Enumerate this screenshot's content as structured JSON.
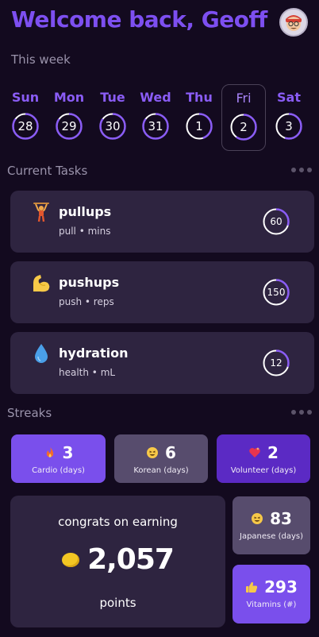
{
  "header": {
    "greeting": "Welcome back, Geoff",
    "avatar_icon": "avatar-face-icon"
  },
  "week": {
    "label": "This week",
    "days": [
      {
        "name": "Sun",
        "date": "28",
        "progress": 0.85,
        "selected": false
      },
      {
        "name": "Mon",
        "date": "29",
        "progress": 0.85,
        "selected": false
      },
      {
        "name": "Tue",
        "date": "30",
        "progress": 0.85,
        "selected": false
      },
      {
        "name": "Wed",
        "date": "31",
        "progress": 0.85,
        "selected": false
      },
      {
        "name": "Thu",
        "date": "1",
        "progress": 0.45,
        "selected": false
      },
      {
        "name": "Fri",
        "date": "2",
        "progress": 0.6,
        "selected": true
      },
      {
        "name": "Sat",
        "date": "3",
        "progress": 0.55,
        "selected": false
      }
    ]
  },
  "tasks": {
    "title": "Current Tasks",
    "items": [
      {
        "name": "pullups",
        "meta": "pull • mins",
        "value": "60",
        "progress": 0.3,
        "icon": "person-pullup-icon"
      },
      {
        "name": "pushups",
        "meta": "push • reps",
        "value": "150",
        "progress": 0.35,
        "icon": "flexed-bicep-icon"
      },
      {
        "name": "hydration",
        "meta": "health • mL",
        "value": "12",
        "progress": 0.3,
        "icon": "water-drop-icon"
      }
    ]
  },
  "streaks": {
    "title": "Streaks",
    "items": [
      {
        "value": "3",
        "label": "Cardio (days)",
        "icon": "fire-icon",
        "color": "#7a4fec"
      },
      {
        "value": "6",
        "label": "Korean (days)",
        "icon": "grinning-face-icon",
        "color": "#574c6d"
      },
      {
        "value": "2",
        "label": "Volunteer (days)",
        "icon": "heart-icon",
        "color": "#5b2ac4"
      },
      {
        "value": "83",
        "label": "Japanese (days)",
        "icon": "grinning-face-icon",
        "color": "#574c6d"
      },
      {
        "value": "293",
        "label": "Vitamins (#)",
        "icon": "thumbs-up-icon",
        "color": "#7a4fec"
      }
    ]
  },
  "points": {
    "caption": "congrats on earning",
    "value": "2,057",
    "unit": "points",
    "icon": "coin-icon"
  },
  "colors": {
    "accent": "#7d4ff0",
    "background": "#130a1f",
    "card": "#2e2440",
    "ring_track": "#ffffff",
    "ring_progress": "#8a5cf5"
  }
}
